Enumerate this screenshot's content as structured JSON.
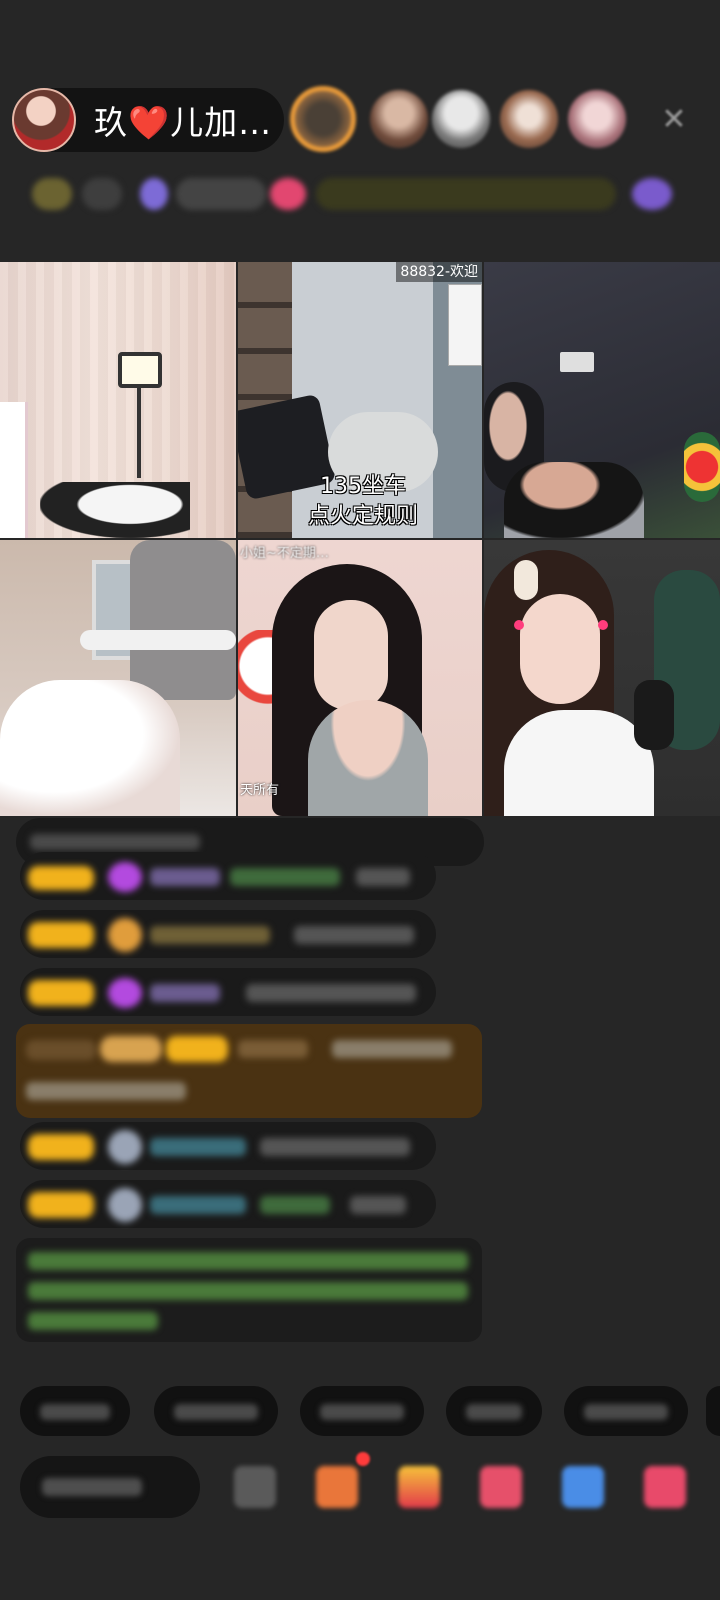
{
  "header": {
    "host_name": "玖❤️儿加…",
    "close_icon": "close-icon"
  },
  "video_tiles": {
    "tile_2": {
      "banner": "88832-欢迎",
      "caption_line1": "135坐车",
      "caption_line2": "点火定规则"
    },
    "tile_5": {
      "corner_text": "天所有"
    }
  },
  "colors": {
    "background": "#262626",
    "pill": "#131313",
    "badge": "#f1b21c",
    "gem": "#b34adf",
    "highlight_row": "#4a3212"
  }
}
